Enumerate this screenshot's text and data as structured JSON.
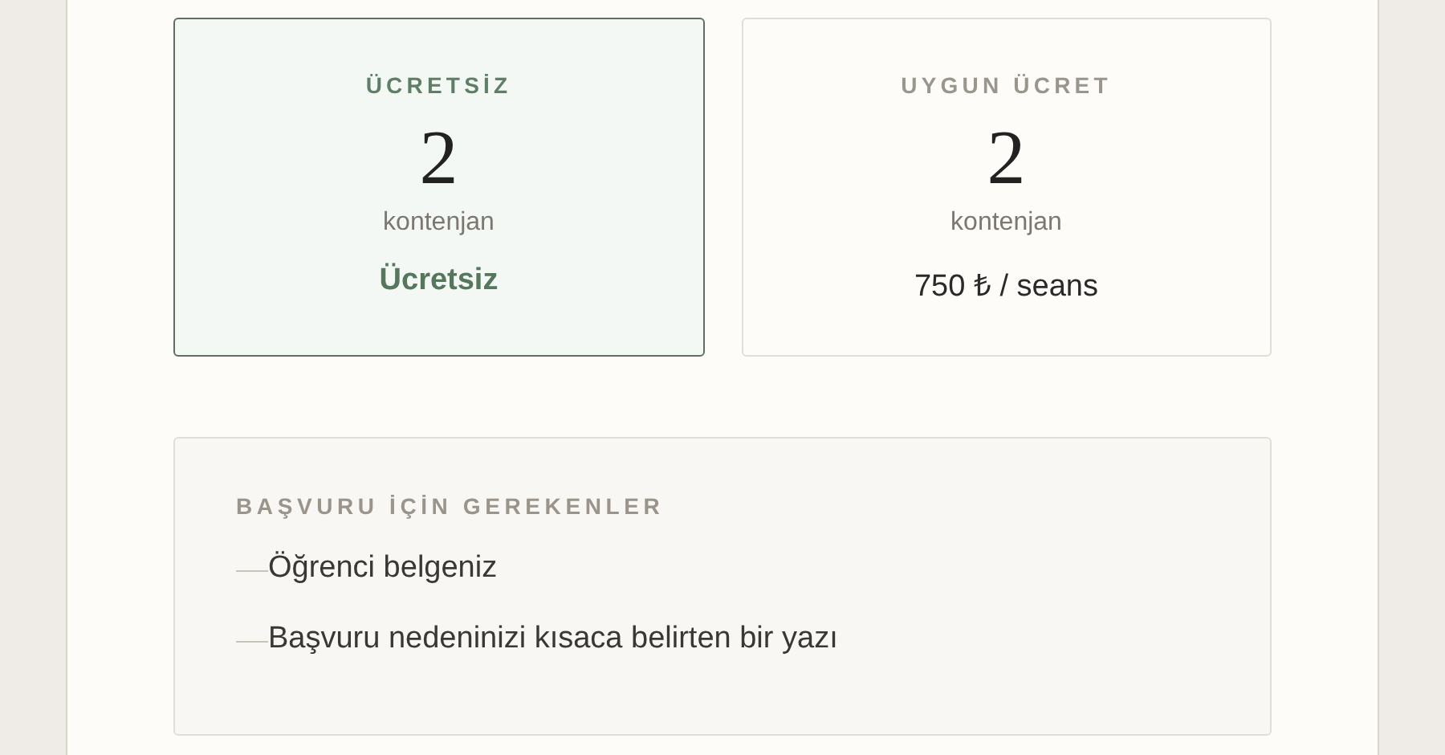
{
  "options": [
    {
      "title": "ÜCRETSİZ",
      "count": "2",
      "unit": "kontenjan",
      "price": "Ücretsiz",
      "selected": true
    },
    {
      "title": "UYGUN ÜCRET",
      "count": "2",
      "unit": "kontenjan",
      "price": "750 ₺ / seans",
      "selected": false
    }
  ],
  "requirements": {
    "title": "BAŞVURU İÇİN GEREKENLER",
    "items": [
      "Öğrenci belgeniz",
      "Başvuru nedeninizi kısaca belirten bir yazı"
    ]
  }
}
